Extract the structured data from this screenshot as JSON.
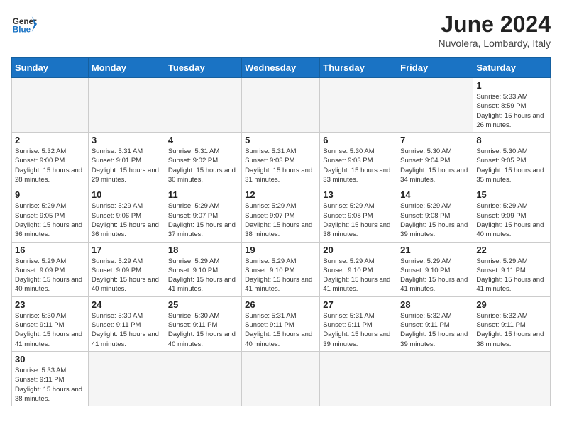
{
  "logo": {
    "text_general": "General",
    "text_blue": "Blue"
  },
  "title": "June 2024",
  "subtitle": "Nuvolera, Lombardy, Italy",
  "days_of_week": [
    "Sunday",
    "Monday",
    "Tuesday",
    "Wednesday",
    "Thursday",
    "Friday",
    "Saturday"
  ],
  "weeks": [
    [
      {
        "day": "",
        "info": ""
      },
      {
        "day": "",
        "info": ""
      },
      {
        "day": "",
        "info": ""
      },
      {
        "day": "",
        "info": ""
      },
      {
        "day": "",
        "info": ""
      },
      {
        "day": "",
        "info": ""
      },
      {
        "day": "1",
        "info": "Sunrise: 5:33 AM\nSunset: 8:59 PM\nDaylight: 15 hours and 26 minutes."
      }
    ],
    [
      {
        "day": "2",
        "info": "Sunrise: 5:32 AM\nSunset: 9:00 PM\nDaylight: 15 hours and 28 minutes."
      },
      {
        "day": "3",
        "info": "Sunrise: 5:31 AM\nSunset: 9:01 PM\nDaylight: 15 hours and 29 minutes."
      },
      {
        "day": "4",
        "info": "Sunrise: 5:31 AM\nSunset: 9:02 PM\nDaylight: 15 hours and 30 minutes."
      },
      {
        "day": "5",
        "info": "Sunrise: 5:31 AM\nSunset: 9:03 PM\nDaylight: 15 hours and 31 minutes."
      },
      {
        "day": "6",
        "info": "Sunrise: 5:30 AM\nSunset: 9:03 PM\nDaylight: 15 hours and 33 minutes."
      },
      {
        "day": "7",
        "info": "Sunrise: 5:30 AM\nSunset: 9:04 PM\nDaylight: 15 hours and 34 minutes."
      },
      {
        "day": "8",
        "info": "Sunrise: 5:30 AM\nSunset: 9:05 PM\nDaylight: 15 hours and 35 minutes."
      }
    ],
    [
      {
        "day": "9",
        "info": "Sunrise: 5:29 AM\nSunset: 9:05 PM\nDaylight: 15 hours and 36 minutes."
      },
      {
        "day": "10",
        "info": "Sunrise: 5:29 AM\nSunset: 9:06 PM\nDaylight: 15 hours and 36 minutes."
      },
      {
        "day": "11",
        "info": "Sunrise: 5:29 AM\nSunset: 9:07 PM\nDaylight: 15 hours and 37 minutes."
      },
      {
        "day": "12",
        "info": "Sunrise: 5:29 AM\nSunset: 9:07 PM\nDaylight: 15 hours and 38 minutes."
      },
      {
        "day": "13",
        "info": "Sunrise: 5:29 AM\nSunset: 9:08 PM\nDaylight: 15 hours and 38 minutes."
      },
      {
        "day": "14",
        "info": "Sunrise: 5:29 AM\nSunset: 9:08 PM\nDaylight: 15 hours and 39 minutes."
      },
      {
        "day": "15",
        "info": "Sunrise: 5:29 AM\nSunset: 9:09 PM\nDaylight: 15 hours and 40 minutes."
      }
    ],
    [
      {
        "day": "16",
        "info": "Sunrise: 5:29 AM\nSunset: 9:09 PM\nDaylight: 15 hours and 40 minutes."
      },
      {
        "day": "17",
        "info": "Sunrise: 5:29 AM\nSunset: 9:09 PM\nDaylight: 15 hours and 40 minutes."
      },
      {
        "day": "18",
        "info": "Sunrise: 5:29 AM\nSunset: 9:10 PM\nDaylight: 15 hours and 41 minutes."
      },
      {
        "day": "19",
        "info": "Sunrise: 5:29 AM\nSunset: 9:10 PM\nDaylight: 15 hours and 41 minutes."
      },
      {
        "day": "20",
        "info": "Sunrise: 5:29 AM\nSunset: 9:10 PM\nDaylight: 15 hours and 41 minutes."
      },
      {
        "day": "21",
        "info": "Sunrise: 5:29 AM\nSunset: 9:10 PM\nDaylight: 15 hours and 41 minutes."
      },
      {
        "day": "22",
        "info": "Sunrise: 5:29 AM\nSunset: 9:11 PM\nDaylight: 15 hours and 41 minutes."
      }
    ],
    [
      {
        "day": "23",
        "info": "Sunrise: 5:30 AM\nSunset: 9:11 PM\nDaylight: 15 hours and 41 minutes."
      },
      {
        "day": "24",
        "info": "Sunrise: 5:30 AM\nSunset: 9:11 PM\nDaylight: 15 hours and 41 minutes."
      },
      {
        "day": "25",
        "info": "Sunrise: 5:30 AM\nSunset: 9:11 PM\nDaylight: 15 hours and 40 minutes."
      },
      {
        "day": "26",
        "info": "Sunrise: 5:31 AM\nSunset: 9:11 PM\nDaylight: 15 hours and 40 minutes."
      },
      {
        "day": "27",
        "info": "Sunrise: 5:31 AM\nSunset: 9:11 PM\nDaylight: 15 hours and 39 minutes."
      },
      {
        "day": "28",
        "info": "Sunrise: 5:32 AM\nSunset: 9:11 PM\nDaylight: 15 hours and 39 minutes."
      },
      {
        "day": "29",
        "info": "Sunrise: 5:32 AM\nSunset: 9:11 PM\nDaylight: 15 hours and 38 minutes."
      }
    ],
    [
      {
        "day": "30",
        "info": "Sunrise: 5:33 AM\nSunset: 9:11 PM\nDaylight: 15 hours and 38 minutes."
      },
      {
        "day": "",
        "info": ""
      },
      {
        "day": "",
        "info": ""
      },
      {
        "day": "",
        "info": ""
      },
      {
        "day": "",
        "info": ""
      },
      {
        "day": "",
        "info": ""
      },
      {
        "day": "",
        "info": ""
      }
    ]
  ]
}
